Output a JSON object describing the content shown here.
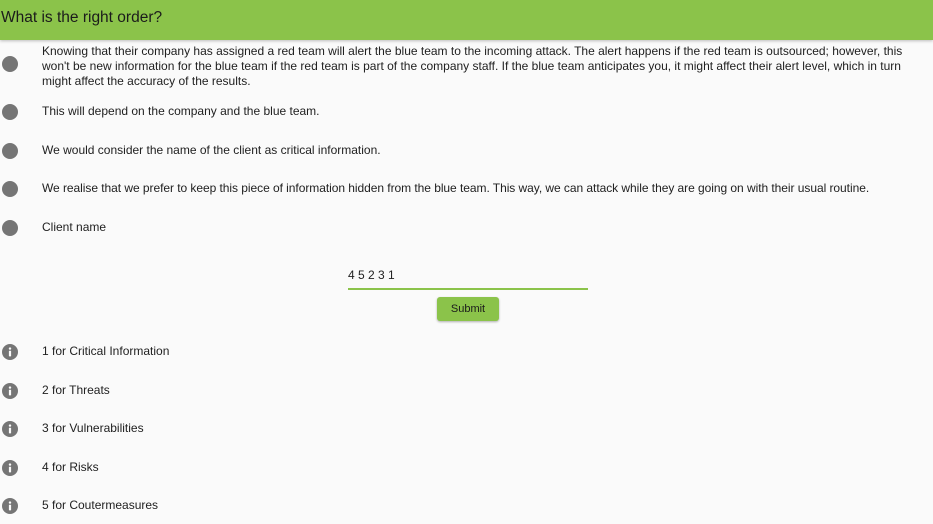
{
  "header": {
    "title": "What is the right order?"
  },
  "options": [
    {
      "text": "Knowing that their company has assigned a red team will alert the blue team to the incoming attack. The alert happens if the red team is outsourced; however, this won't be new information for the blue team if the red team is part of the company staff. If the blue team anticipates you, it might affect their alert level, which in turn might affect the accuracy of the results."
    },
    {
      "text": "This will depend on the company and the blue team."
    },
    {
      "text": "We would consider the name of the client as critical information."
    },
    {
      "text": "We realise that we prefer to keep this piece of information hidden from the blue team. This way, we can attack while they are going on with their usual routine."
    },
    {
      "text": "Client name"
    }
  ],
  "answer": {
    "value": "4 5 2 3 1"
  },
  "submit": {
    "label": "Submit"
  },
  "legend": [
    {
      "text": "1 for Critical Information",
      "icon": "info-icon"
    },
    {
      "text": "2 for Threats",
      "icon": "info-icon"
    },
    {
      "text": "3 for Vulnerabilities",
      "icon": "info-icon"
    },
    {
      "text": "4 for Risks",
      "icon": "info-icon"
    },
    {
      "text": "5 for Coutermeasures",
      "icon": "info-icon"
    }
  ],
  "colors": {
    "accent": "#8bc34a",
    "dot": "#757575",
    "background": "#fafafa"
  }
}
